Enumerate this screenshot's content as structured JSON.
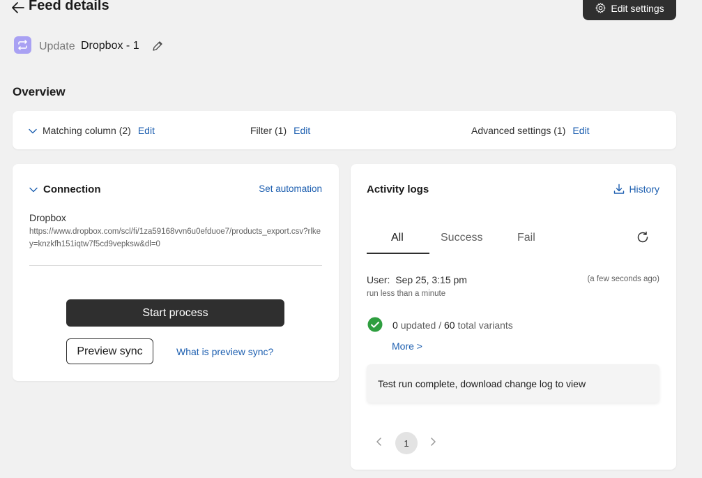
{
  "header": {
    "title": "Feed details",
    "edit_settings": "Edit settings",
    "feed_type": "Update",
    "feed_name": "Dropbox - 1"
  },
  "overview": {
    "title": "Overview",
    "matching": "Matching column (2)",
    "filter": "Filter (1)",
    "advanced": "Advanced settings (1)",
    "edit_label": "Edit"
  },
  "connection": {
    "title": "Connection",
    "set_automation": "Set automation",
    "source_name": "Dropbox",
    "url": "https://www.dropbox.com/scl/fi/1za59168vvn6u0efduoe7/products_export.csv?rlkey=knzkfh151iqtw7f5cd9vepksw&dl=0",
    "start_process": "Start process",
    "preview_sync": "Preview sync",
    "what_is_preview": "What is preview sync?"
  },
  "activity": {
    "title": "Activity logs",
    "history": "History",
    "tabs": [
      "All",
      "Success",
      "Fail"
    ],
    "user_line": "User:  Sep 25, 3:15 pm",
    "ago": "(a few seconds ago)",
    "run_info": "run less than a minute",
    "updated_count": "0",
    "updated_label": "updated",
    "total_count": "60",
    "total_label": "total variants",
    "more": "More >",
    "message": "Test run complete, download change log to view",
    "page": "1"
  },
  "colors": {
    "primary_dark": "#2f2f2f",
    "link": "#1d5fb0",
    "feed_icon": "#a9a1f3",
    "success": "#2e9e3f"
  }
}
